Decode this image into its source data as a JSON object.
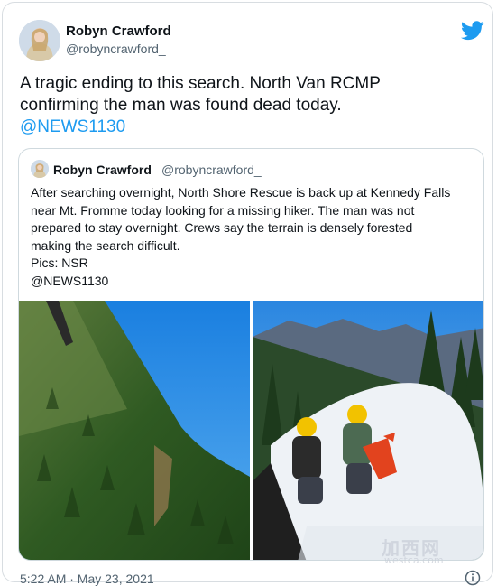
{
  "tweet": {
    "author_name": "Robyn Crawford",
    "author_handle": "@robyncrawford_",
    "text_lines": [
      "A tragic ending to this search. North Van RCMP",
      "confirming the man was found dead today."
    ],
    "mention": "@NEWS1130",
    "timestamp": "5:22 AM · May 23, 2021"
  },
  "quoted_tweet": {
    "author_name": "Robyn Crawford",
    "author_handle": "@robyncrawford_",
    "text_lines": [
      "After searching overnight, North Shore Rescue is back up at Kennedy Falls",
      "near Mt. Fromme today looking for a missing hiker. The man was not",
      "prepared to stay overnight. Crews say the terrain is densely forested",
      "making the search difficult.",
      "Pics: NSR",
      "@NEWS1130"
    ]
  },
  "watermark": {
    "text": "加西网",
    "subtext": "westca.com"
  },
  "icons": {
    "brand": "twitter-bird-icon",
    "info": "info-icon"
  },
  "colors": {
    "accent": "#1d9bf0",
    "secondary_text": "#536471",
    "border": "#cfd9de"
  }
}
